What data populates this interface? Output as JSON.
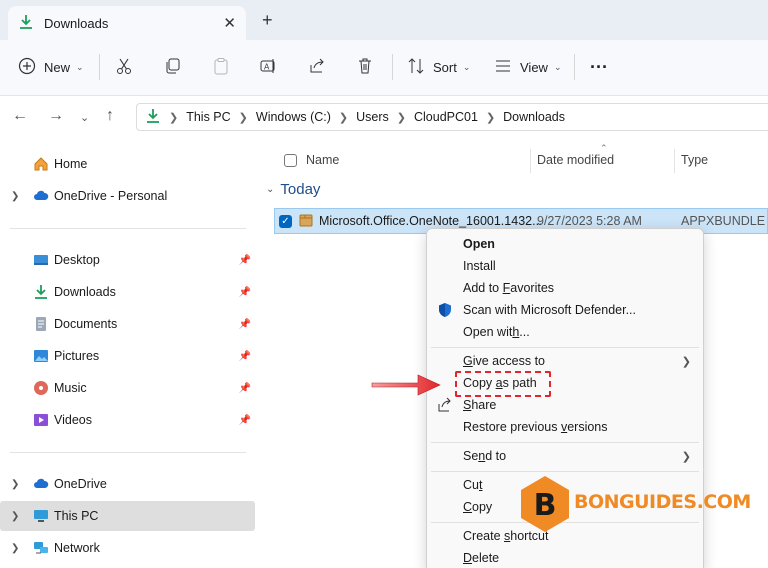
{
  "tab": {
    "title": "Downloads",
    "close": "✕",
    "new_tab": "+"
  },
  "toolbar": {
    "new_label": "New",
    "sort_label": "Sort",
    "view_label": "View",
    "more_label": "···"
  },
  "address": {
    "crumbs": [
      "This PC",
      "Windows (C:)",
      "Users",
      "CloudPC01",
      "Downloads"
    ]
  },
  "nav": {
    "items": [
      {
        "label": "Home"
      },
      {
        "label": "OneDrive - Personal"
      },
      {
        "label": "Desktop"
      },
      {
        "label": "Downloads"
      },
      {
        "label": "Documents"
      },
      {
        "label": "Pictures"
      },
      {
        "label": "Music"
      },
      {
        "label": "Videos"
      },
      {
        "label": "OneDrive"
      },
      {
        "label": "This PC"
      },
      {
        "label": "Network"
      }
    ]
  },
  "columns": {
    "name": "Name",
    "date": "Date modified",
    "type": "Type"
  },
  "group": {
    "title": "Today"
  },
  "file": {
    "name": "Microsoft.Office.OneNote_16001.1432...",
    "date": "9/27/2023 5:28 AM",
    "type": "APPXBUNDLE File"
  },
  "context_menu": {
    "open": "Open",
    "install": "Install",
    "add_fav_pre": "Add to ",
    "add_fav_u": "F",
    "add_fav_post": "avorites",
    "scan": "Scan with Microsoft Defender...",
    "open_with_pre": "Open wit",
    "open_with_u": "h",
    "open_with_post": "...",
    "give_access_pre": "",
    "give_access_u": "G",
    "give_access_post": "ive access to",
    "copy_path_pre": "Copy ",
    "copy_path_u": "a",
    "copy_path_post": "s path",
    "share_pre": "",
    "share_u": "S",
    "share_post": "hare",
    "restore_pre": "Restore previous ",
    "restore_u": "v",
    "restore_post": "ersions",
    "send_to_pre": "Se",
    "send_to_u": "n",
    "send_to_post": "d to",
    "cut_pre": "Cu",
    "cut_u": "t",
    "cut_post": "",
    "copy_pre": "",
    "copy_u": "C",
    "copy_post": "opy",
    "create_shortcut_pre": "Create ",
    "create_shortcut_u": "s",
    "create_shortcut_post": "hortcut",
    "delete_pre": "",
    "delete_u": "D",
    "delete_post": "elete"
  },
  "watermark": {
    "text": "BONGUIDES.COM",
    "letter": "B"
  },
  "colors": {
    "accent": "#0067c0",
    "selection": "#cce4f7",
    "annotation": "#e3262b",
    "brand": "#f08a24"
  }
}
